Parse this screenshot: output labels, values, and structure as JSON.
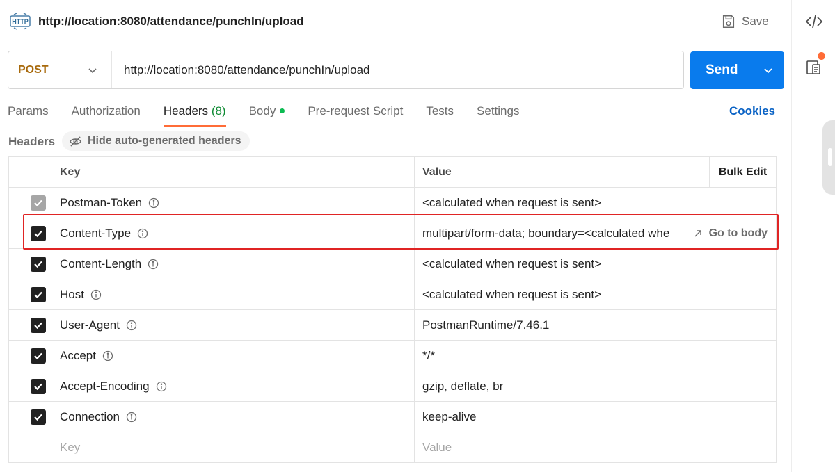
{
  "request": {
    "title": "http://location:8080/attendance/punchIn/upload",
    "badge": "HTTP",
    "save_label": "Save"
  },
  "urlbar": {
    "method": "POST",
    "url": "http://location:8080/attendance/punchIn/upload",
    "send_label": "Send"
  },
  "tabs": [
    {
      "label": "Params"
    },
    {
      "label": "Authorization"
    },
    {
      "label": "Headers",
      "count": "(8)"
    },
    {
      "label": "Body"
    },
    {
      "label": "Pre-request Script"
    },
    {
      "label": "Tests"
    },
    {
      "label": "Settings"
    }
  ],
  "cookies_label": "Cookies",
  "headers_section": {
    "label": "Headers",
    "hide_auto_label": "Hide auto-generated headers"
  },
  "table": {
    "col_key": "Key",
    "col_value": "Value",
    "bulk_edit": "Bulk Edit",
    "rows": [
      {
        "key": "Postman-Token",
        "value": "<calculated when request is sent>"
      },
      {
        "key": "Content-Type",
        "value": "multipart/form-data; boundary=<calculated whe",
        "action": "Go to body"
      },
      {
        "key": "Content-Length",
        "value": "<calculated when request is sent>"
      },
      {
        "key": "Host",
        "value": "<calculated when request is sent>"
      },
      {
        "key": "User-Agent",
        "value": "PostmanRuntime/7.46.1"
      },
      {
        "key": "Accept",
        "value": "*/*"
      },
      {
        "key": "Accept-Encoding",
        "value": "gzip, deflate, br"
      },
      {
        "key": "Connection",
        "value": "keep-alive"
      }
    ],
    "new_key_placeholder": "Key",
    "new_value_placeholder": "Value"
  },
  "colors": {
    "accent": "#ff6c37",
    "send": "#097bed",
    "method": "#a86a0d",
    "highlight": "#e02424",
    "cookies": "#0b63c5"
  },
  "icons": {
    "badge": "http-icon",
    "save": "floppy-disk-icon",
    "method_dropdown": "chevron-down-icon",
    "send_dropdown": "chevron-down-icon",
    "hide_auto": "eye-off-icon",
    "info": "info-icon",
    "goto": "arrow-up-right-icon",
    "rail_code": "code-icon",
    "rail_doc": "documentation-icon",
    "checkbox": "check-icon"
  }
}
